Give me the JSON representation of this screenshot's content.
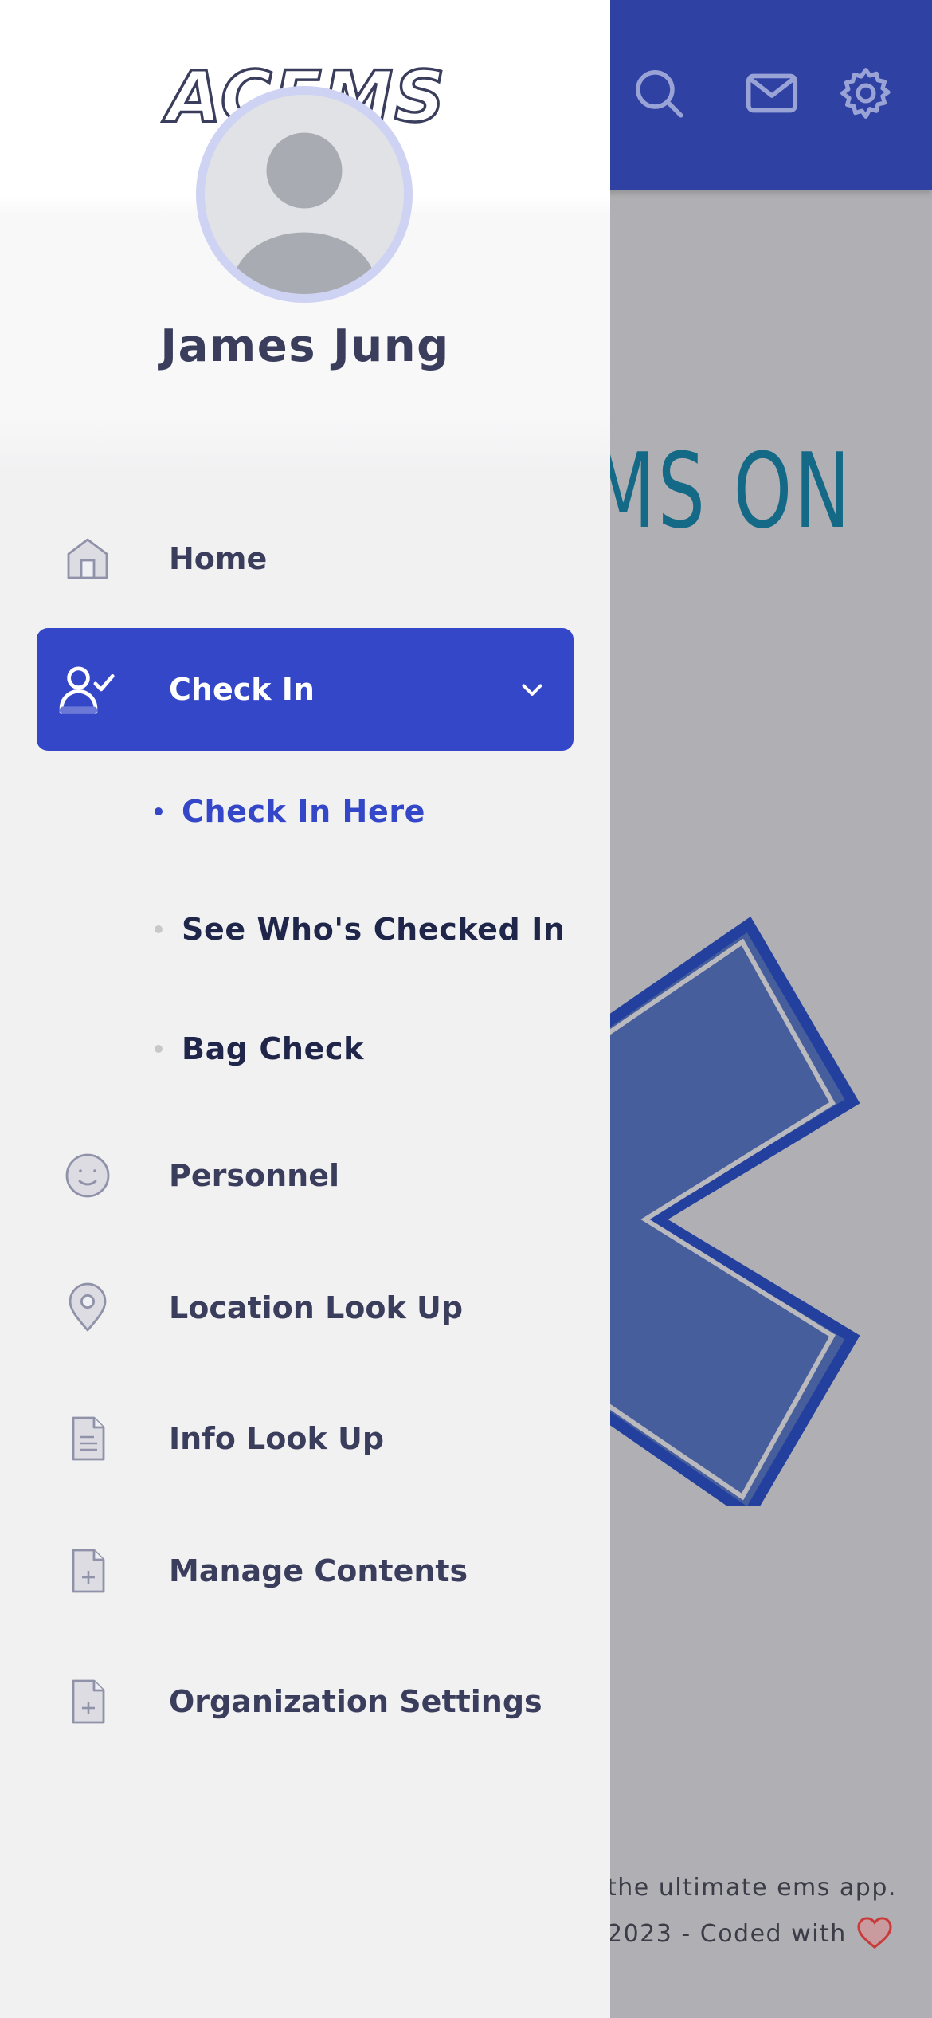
{
  "app": {
    "brand": "ACEMS",
    "hero_text": "EMS ON",
    "footer_line1": "the ultimate ems app.",
    "footer_line2": "2023 - Coded with",
    "colors": {
      "topbar": "#2f41a3",
      "active_nav": "#3347c8",
      "hero_text": "#146a86",
      "star_fill": "#465e9c",
      "star_outline": "#23409e",
      "heart": "#c93a3a"
    }
  },
  "topbar": {
    "icons": [
      "search-icon",
      "mail-icon",
      "gear-icon"
    ]
  },
  "drawer": {
    "user_name": "James Jung",
    "nav": [
      {
        "label": "Home",
        "icon": "home-icon"
      },
      {
        "label": "Check In",
        "icon": "user-check-icon",
        "active": true,
        "expanded": true
      },
      {
        "label": "Personnel",
        "icon": "smile-icon"
      },
      {
        "label": "Location Look Up",
        "icon": "map-pin-icon"
      },
      {
        "label": "Info Look Up",
        "icon": "document-icon"
      },
      {
        "label": "Manage Contents",
        "icon": "file-plus-icon"
      },
      {
        "label": "Organization Settings",
        "icon": "file-plus-icon"
      }
    ],
    "check_in_sub": [
      {
        "label": "Check In Here",
        "active": true
      },
      {
        "label": "See Who's Checked In"
      },
      {
        "label": "Bag Check"
      }
    ]
  }
}
